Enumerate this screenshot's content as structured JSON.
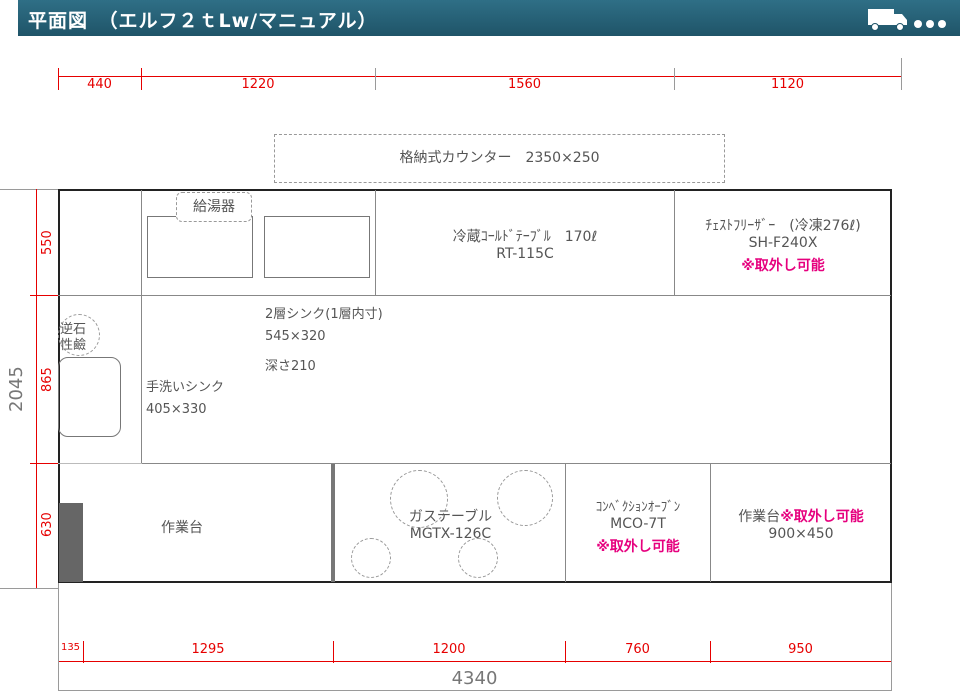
{
  "header": {
    "title": "平面図　（エルフ２ｔLw/マニュアル）",
    "accent_color": "#2a6478",
    "icon": "truck-icon"
  },
  "top_dims": [
    "440",
    "1220",
    "1560",
    "1120"
  ],
  "bottom_dims": [
    "135",
    "1295",
    "1200",
    "760",
    "950"
  ],
  "total_width": "4340",
  "left_dims": [
    "550",
    "865",
    "630"
  ],
  "total_height": "2045",
  "counter": {
    "label": "格納式カウンター　2350×250"
  },
  "water_heater": {
    "label": "給湯器"
  },
  "cold_table": {
    "name": "冷蔵ｺｰﾙﾄﾞﾃｰﾌﾞﾙ　170ℓ",
    "model": "RT-115C"
  },
  "freezer": {
    "name": "ﾁｪｽﾄﾌﾘｰｻﾞｰ　(冷凍276ℓ)",
    "model": "SH-F240X",
    "note": "※取外し可能"
  },
  "sink2": {
    "line1": "2層シンク(1層内寸)",
    "line2": "545×320",
    "line3": "深さ210"
  },
  "check_valve": {
    "line1": "逆石",
    "line2": "性鹼"
  },
  "hand_sink": {
    "line1": "手洗いシンク",
    "line2": "405×330"
  },
  "worktable_left": {
    "label": "作業台"
  },
  "gas_table": {
    "name": "ガステーブル",
    "model": "MGTX-126C"
  },
  "convection": {
    "name": "ｺﾝﾍﾞｸｼｮﾝｵｰﾌﾞﾝ",
    "model": "MCO-7T",
    "note": "※取外し可能"
  },
  "worktable_right": {
    "name": "作業台",
    "note": "※取外し可能",
    "size": "900×450"
  },
  "colors": {
    "dimension": "#e60000",
    "removable": "#e6007e"
  }
}
